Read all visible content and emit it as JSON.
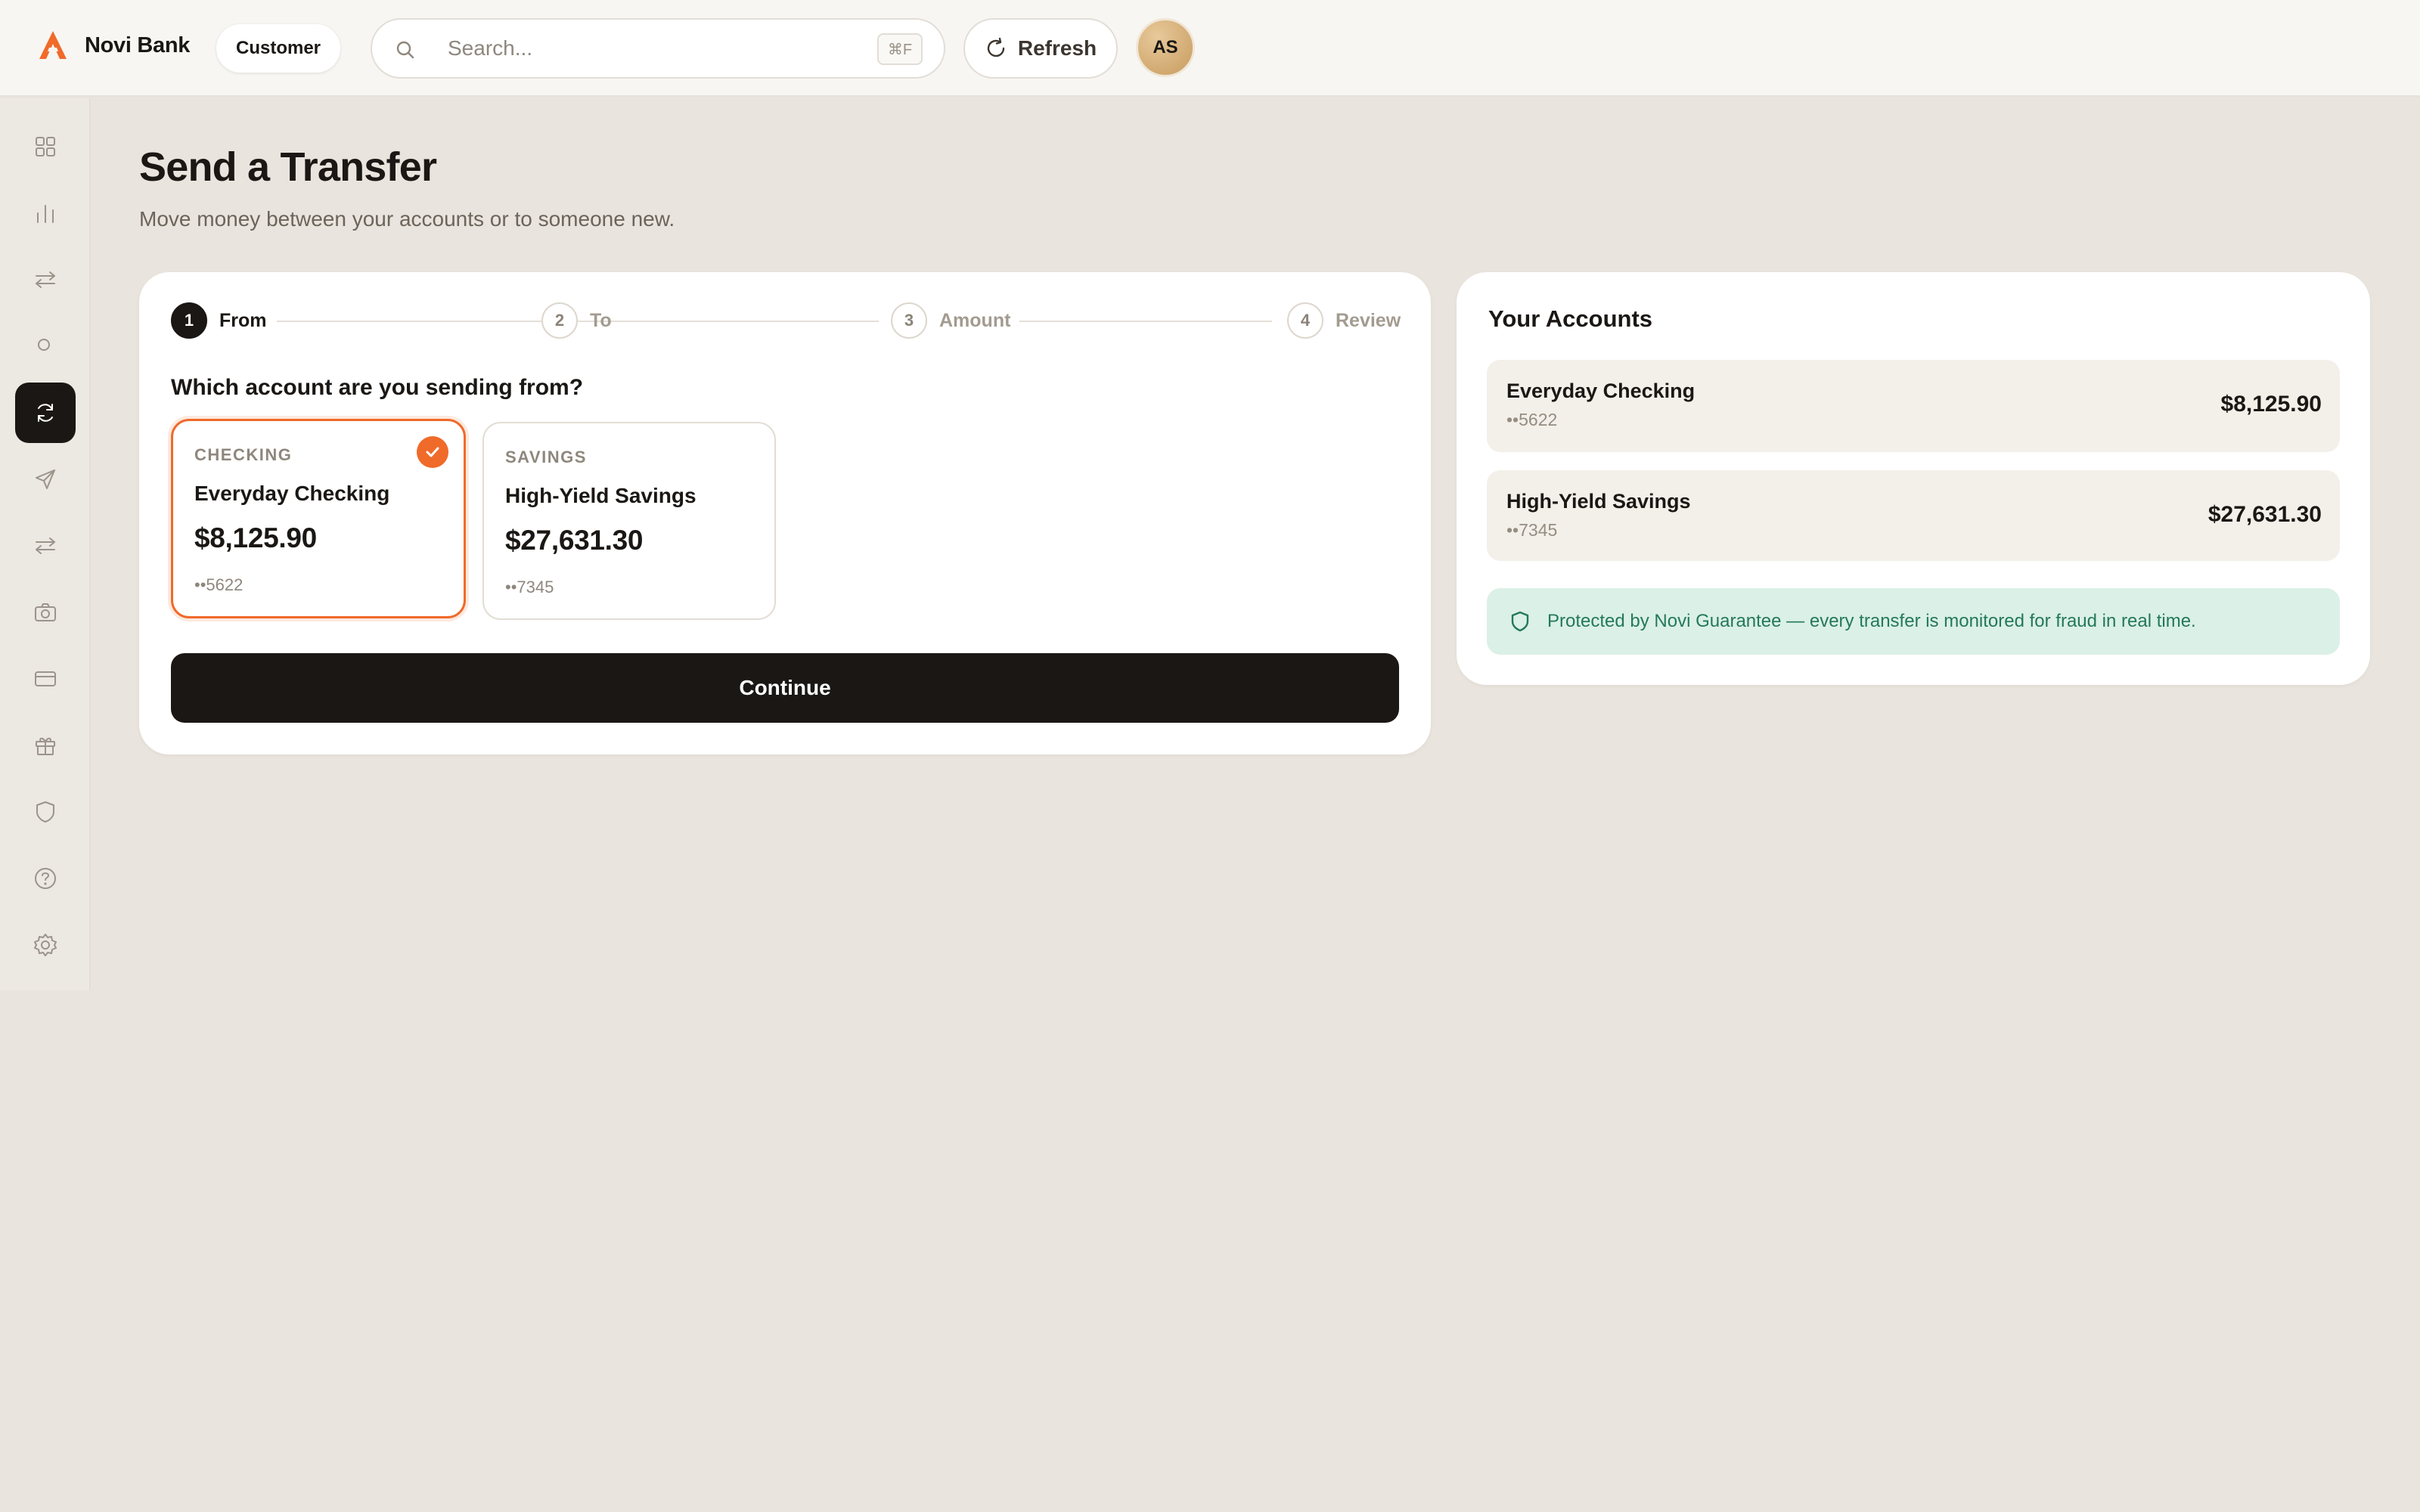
{
  "topbar": {
    "brand_name": "Novi Bank",
    "role_label": "Customer",
    "search_placeholder": "Search...",
    "search_value": "",
    "search_shortcut": "⌘F",
    "refresh_label": "Refresh",
    "avatar_initials": "AS"
  },
  "colors": {
    "accent": "#f06a2a",
    "primary_dark": "#1a1714",
    "background": "#e9e4dd",
    "success_bg": "#dbf0e6",
    "success_text": "#23795a"
  },
  "sidebar": {
    "items": [
      {
        "icon": "grid-icon",
        "active": false
      },
      {
        "icon": "bar-chart-icon",
        "active": false
      },
      {
        "icon": "arrows-swap-icon",
        "active": false
      },
      {
        "icon": "circle-icon",
        "active": false
      },
      {
        "icon": "refresh-cycle-icon",
        "active": true
      },
      {
        "icon": "send-icon",
        "active": false
      },
      {
        "icon": "transfer-icon",
        "active": false
      },
      {
        "icon": "camera-icon",
        "active": false
      },
      {
        "icon": "card-icon",
        "active": false
      },
      {
        "icon": "gift-icon",
        "active": false
      },
      {
        "icon": "shield-icon",
        "active": false
      },
      {
        "icon": "help-icon",
        "active": false
      },
      {
        "icon": "settings-icon",
        "active": false
      }
    ]
  },
  "page": {
    "title": "Send a Transfer",
    "subtitle": "Move money between your accounts or to someone new."
  },
  "transfer": {
    "steps": [
      {
        "number": "1",
        "label": "From",
        "active": true
      },
      {
        "number": "2",
        "label": "To",
        "active": false
      },
      {
        "number": "3",
        "label": "Amount",
        "active": false
      },
      {
        "number": "4",
        "label": "Review",
        "active": false
      }
    ],
    "question": "Which account are you sending from?",
    "options": [
      {
        "type": "CHECKING",
        "name": "Everyday Checking",
        "balance": "$8,125.90",
        "mask": "••5622",
        "selected": true
      },
      {
        "type": "SAVINGS",
        "name": "High-Yield Savings",
        "balance": "$27,631.30",
        "mask": "••7345",
        "selected": false
      }
    ],
    "continue_label": "Continue"
  },
  "accounts": {
    "title": "Your Accounts",
    "items": [
      {
        "name": "Everyday Checking",
        "mask": "••5622",
        "balance": "$8,125.90"
      },
      {
        "name": "High-Yield Savings",
        "mask": "••7345",
        "balance": "$27,631.30"
      }
    ],
    "guarantee_text": "Protected by Novi Guarantee — every transfer is monitored for fraud in real time."
  }
}
